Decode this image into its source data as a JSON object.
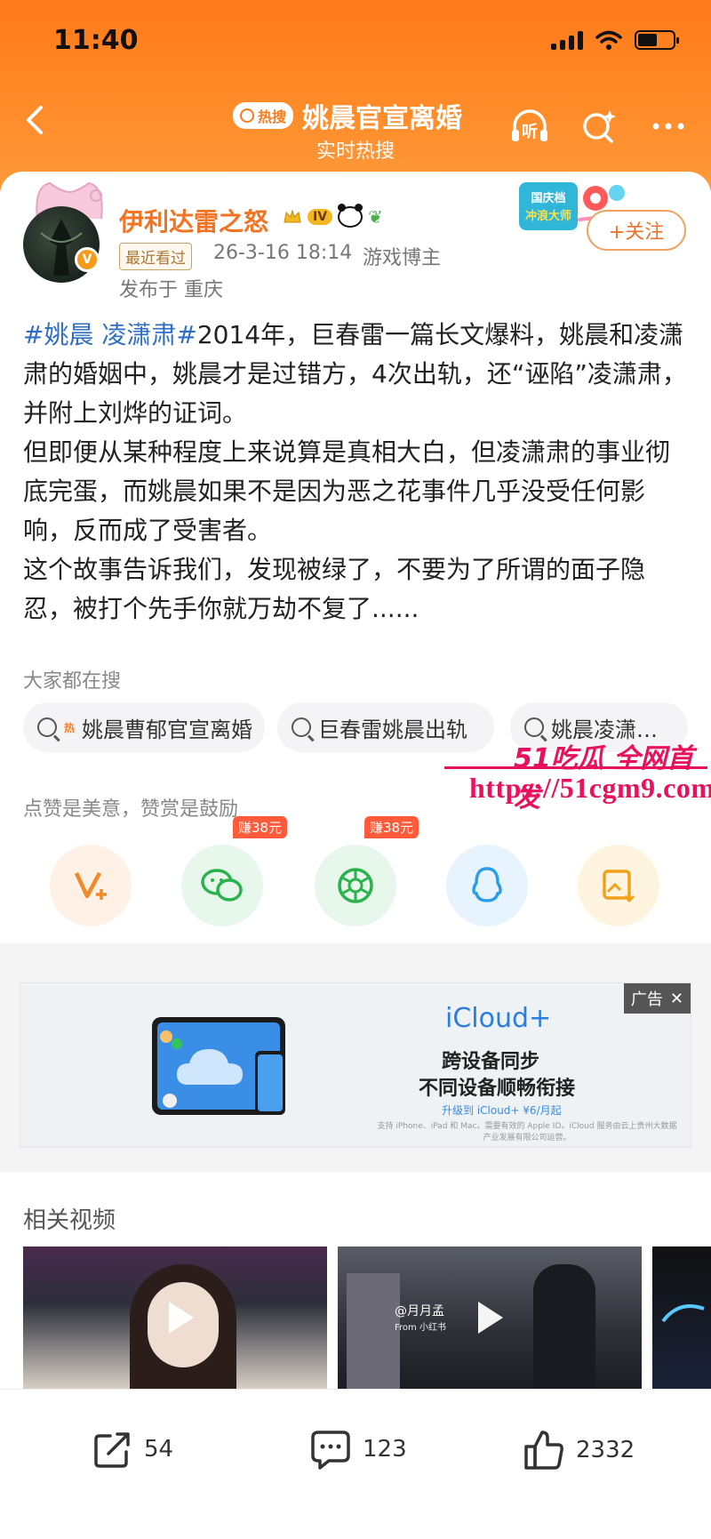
{
  "status_bar": {
    "time": "11:40"
  },
  "header": {
    "badge": "热搜",
    "title": "姚晨官宣离婚",
    "subtitle": "实时热搜",
    "listen_label": "听"
  },
  "author": {
    "name": "伊利达雷之怒",
    "level": "IV",
    "recent_tag": "最近看过",
    "time": "26-3-16 18:14",
    "role": "游戏博主",
    "location": "发布于 重庆",
    "follow_label": "+关注",
    "promo_text": [
      "国庆档",
      "冲浪大师"
    ]
  },
  "post": {
    "hashtag": "#姚晨 凌潇肃#",
    "p1": "2014年，巨春雷一篇长文爆料，姚晨和凌潇肃的婚姻中，姚晨才是过错方，4次出轨，还“诬陷”凌潇肃，并附上刘烨的证词。",
    "p2": "但即便从某种程度上来说算是真相大白，但凌潇肃的事业彻底完蛋，而姚晨如果不是因为恶之花事件几乎没受任何影响，反而成了受害者。",
    "p3": "这个故事告诉我们，发现被绿了，不要为了所谓的面子隐忍，被打个先手你就万劫不复了......"
  },
  "searches": {
    "label": "大家都在搜",
    "hot_tag": "热",
    "items": [
      "姚晨曹郁官宣离婚",
      "巨春雷姚晨出轨",
      "姚晨凌潇…"
    ]
  },
  "watermark": {
    "line1": "51吃瓜 全网首发",
    "url": "https://51cgm9.com"
  },
  "appreciate": {
    "label": "点赞是美意，赞赏是鼓励",
    "reward1": "赚38元",
    "reward2": "赚38元"
  },
  "ad": {
    "tag": "广告",
    "title": "iCloud+",
    "line1": "跨设备同步",
    "line2": "不同设备顺畅衔接",
    "line3": "升级到 iCloud+ ¥6/月起",
    "fine": "支持 iPhone、iPad 和 Mac。需要有效的 Apple ID。iCloud 服务由云上贵州大数据产业发展有限公司运营。"
  },
  "related": {
    "label": "相关视频",
    "video2_caption": "@月月孟",
    "video2_from": "From 小红书"
  },
  "actions": {
    "share": "54",
    "comment": "123",
    "like": "2332"
  },
  "colors": {
    "brand_orange": "#ff7a1a",
    "link_blue": "#2e6ec4",
    "username": "#f17424"
  }
}
